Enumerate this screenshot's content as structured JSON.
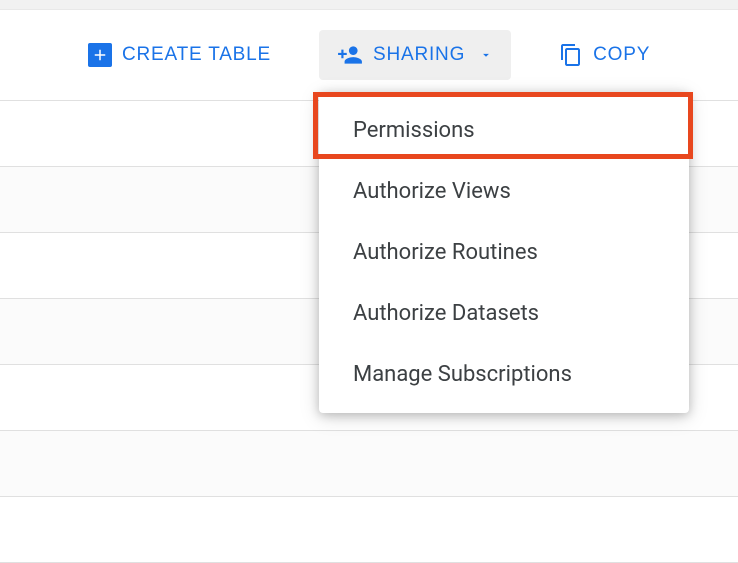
{
  "toolbar": {
    "create_table": {
      "label": "CREATE TABLE"
    },
    "sharing": {
      "label": "SHARING"
    },
    "copy": {
      "label": "COPY"
    }
  },
  "dropdown": {
    "items": [
      {
        "label": "Permissions"
      },
      {
        "label": "Authorize Views"
      },
      {
        "label": "Authorize Routines"
      },
      {
        "label": "Authorize Datasets"
      },
      {
        "label": "Manage Subscriptions"
      }
    ]
  },
  "highlighted_item_index": 0
}
